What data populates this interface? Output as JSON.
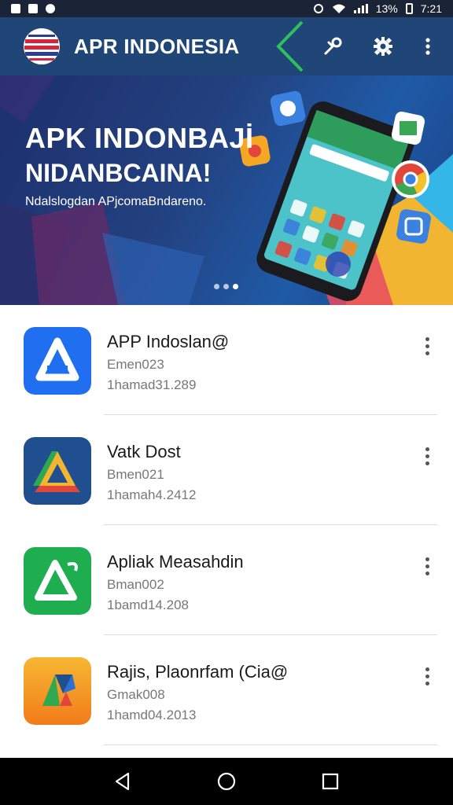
{
  "status_bar": {
    "battery_text": "13%",
    "time": "7:21"
  },
  "app_bar": {
    "title": "APR INDONESIA",
    "icons": [
      "logo-icon",
      "tools-icon",
      "settings-gear-icon",
      "more-vert-icon"
    ]
  },
  "banner": {
    "title_line1": "APK INDONBAJİ",
    "title_line2": "NIDANBCAINA!",
    "subtitle": "Ndalslogdan APjcomaBndareno.",
    "page_indicator": {
      "count": 3,
      "active_index": 2
    }
  },
  "apps": [
    {
      "name": "APP Indoslan@",
      "developer": "Emen023",
      "meta": "1hamad31.289",
      "icon": "app-a-icon",
      "icon_color": "#1f6ff0"
    },
    {
      "name": "Vatk Dost",
      "developer": "Bmen021",
      "meta": "1hamah4.2412",
      "icon": "drive-triangle-icon",
      "icon_color": "#1f4f8f"
    },
    {
      "name": "Apliak Measahdin",
      "developer": "Bman002",
      "meta": "1bamd14.208",
      "icon": "green-a-icon",
      "icon_color": "#1fae4f"
    },
    {
      "name": "Rajis, Plaonrfam (Cia@",
      "developer": "Gmak008",
      "meta": "1hamd04.2013",
      "icon": "orange-drive-icon",
      "icon_color": "#f39a1a"
    }
  ],
  "nav_bar": {
    "icons": [
      "back-icon",
      "home-icon",
      "recents-icon"
    ]
  },
  "colors": {
    "app_bar": "#1f4677",
    "accent_green": "#2fbf5f",
    "banner_bg": "#23407e"
  }
}
